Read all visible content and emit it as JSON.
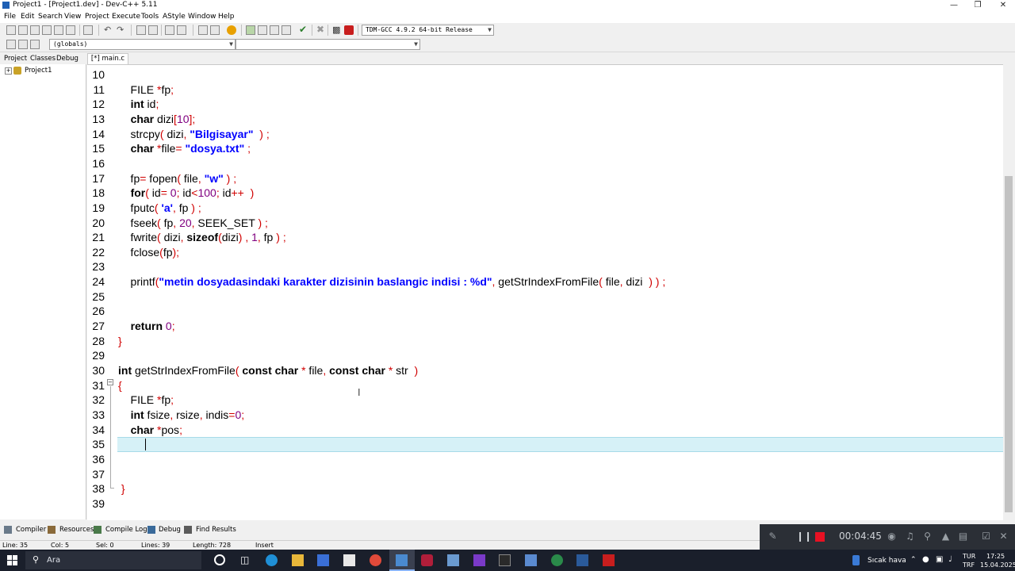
{
  "window": {
    "title": "Project1 - [Project1.dev] - Dev-C++ 5.11"
  },
  "menu": [
    "File",
    "Edit",
    "Search",
    "View",
    "Project",
    "Execute",
    "Tools",
    "AStyle",
    "Window",
    "Help"
  ],
  "toolbar": {
    "compiler": "TDM-GCC 4.9.2 64-bit Release",
    "scope": "(globals)",
    "member": ""
  },
  "left_tabs": [
    "Project",
    "Classes",
    "Debug"
  ],
  "project_tree": {
    "root": "Project1"
  },
  "editor": {
    "tab": "[*] main.c",
    "lines": [
      {
        "n": "10",
        "t": []
      },
      {
        "n": "11",
        "t": [
          {
            "c": "    FILE "
          },
          {
            "c": "*",
            "s": "sym"
          },
          {
            "c": "fp"
          },
          {
            "c": ";",
            "s": "sym"
          }
        ]
      },
      {
        "n": "12",
        "t": [
          {
            "c": "    "
          },
          {
            "c": "int",
            "s": "kw"
          },
          {
            "c": " id"
          },
          {
            "c": ";",
            "s": "sym"
          }
        ]
      },
      {
        "n": "13",
        "t": [
          {
            "c": "    "
          },
          {
            "c": "char",
            "s": "kw"
          },
          {
            "c": " dizi"
          },
          {
            "c": "[",
            "s": "sym"
          },
          {
            "c": "10",
            "s": "num"
          },
          {
            "c": "];",
            "s": "sym"
          }
        ]
      },
      {
        "n": "14",
        "t": [
          {
            "c": "    strcpy"
          },
          {
            "c": "(",
            "s": "sym"
          },
          {
            "c": " dizi"
          },
          {
            "c": ",",
            "s": "sym"
          },
          {
            "c": " "
          },
          {
            "c": "\"Bilgisayar\"",
            "s": "str"
          },
          {
            "c": "  "
          },
          {
            "c": ")",
            "s": "sym"
          },
          {
            "c": " "
          },
          {
            "c": ";",
            "s": "sym"
          }
        ]
      },
      {
        "n": "15",
        "t": [
          {
            "c": "    "
          },
          {
            "c": "char",
            "s": "kw"
          },
          {
            "c": " "
          },
          {
            "c": "*",
            "s": "sym"
          },
          {
            "c": "file"
          },
          {
            "c": "=",
            "s": "sym"
          },
          {
            "c": " "
          },
          {
            "c": "\"dosya.txt\"",
            "s": "str"
          },
          {
            "c": " "
          },
          {
            "c": ";",
            "s": "sym"
          }
        ]
      },
      {
        "n": "16",
        "t": []
      },
      {
        "n": "17",
        "t": [
          {
            "c": "    fp"
          },
          {
            "c": "=",
            "s": "sym"
          },
          {
            "c": " fopen"
          },
          {
            "c": "(",
            "s": "sym"
          },
          {
            "c": " file"
          },
          {
            "c": ",",
            "s": "sym"
          },
          {
            "c": " "
          },
          {
            "c": "\"w\"",
            "s": "str"
          },
          {
            "c": " "
          },
          {
            "c": ")",
            "s": "sym"
          },
          {
            "c": " "
          },
          {
            "c": ";",
            "s": "sym"
          }
        ]
      },
      {
        "n": "18",
        "t": [
          {
            "c": "    "
          },
          {
            "c": "for",
            "s": "kw"
          },
          {
            "c": "(",
            "s": "sym"
          },
          {
            "c": " id"
          },
          {
            "c": "=",
            "s": "sym"
          },
          {
            "c": " "
          },
          {
            "c": "0",
            "s": "num"
          },
          {
            "c": ";",
            "s": "sym"
          },
          {
            "c": " id"
          },
          {
            "c": "<",
            "s": "sym"
          },
          {
            "c": "100",
            "s": "num"
          },
          {
            "c": ";",
            "s": "sym"
          },
          {
            "c": " id"
          },
          {
            "c": "++",
            "s": "sym"
          },
          {
            "c": "  "
          },
          {
            "c": ")",
            "s": "sym"
          }
        ]
      },
      {
        "n": "19",
        "t": [
          {
            "c": "    fputc"
          },
          {
            "c": "(",
            "s": "sym"
          },
          {
            "c": " "
          },
          {
            "c": "'a'",
            "s": "str"
          },
          {
            "c": ",",
            "s": "sym"
          },
          {
            "c": " fp "
          },
          {
            "c": ")",
            "s": "sym"
          },
          {
            "c": " "
          },
          {
            "c": ";",
            "s": "sym"
          }
        ]
      },
      {
        "n": "20",
        "t": [
          {
            "c": "    fseek"
          },
          {
            "c": "(",
            "s": "sym"
          },
          {
            "c": " fp"
          },
          {
            "c": ",",
            "s": "sym"
          },
          {
            "c": " "
          },
          {
            "c": "20",
            "s": "num"
          },
          {
            "c": ",",
            "s": "sym"
          },
          {
            "c": " SEEK_SET "
          },
          {
            "c": ")",
            "s": "sym"
          },
          {
            "c": " "
          },
          {
            "c": ";",
            "s": "sym"
          }
        ]
      },
      {
        "n": "21",
        "t": [
          {
            "c": "    fwrite"
          },
          {
            "c": "(",
            "s": "sym"
          },
          {
            "c": " dizi"
          },
          {
            "c": ",",
            "s": "sym"
          },
          {
            "c": " "
          },
          {
            "c": "sizeof",
            "s": "kw"
          },
          {
            "c": "(",
            "s": "sym"
          },
          {
            "c": "dizi"
          },
          {
            "c": ")",
            "s": "sym"
          },
          {
            "c": " "
          },
          {
            "c": ",",
            "s": "sym"
          },
          {
            "c": " "
          },
          {
            "c": "1",
            "s": "num"
          },
          {
            "c": ",",
            "s": "sym"
          },
          {
            "c": " fp "
          },
          {
            "c": ")",
            "s": "sym"
          },
          {
            "c": " "
          },
          {
            "c": ";",
            "s": "sym"
          }
        ]
      },
      {
        "n": "22",
        "t": [
          {
            "c": "    fclose"
          },
          {
            "c": "(",
            "s": "sym"
          },
          {
            "c": "fp"
          },
          {
            "c": ");",
            "s": "sym"
          }
        ]
      },
      {
        "n": "23",
        "t": []
      },
      {
        "n": "24",
        "t": [
          {
            "c": "    printf"
          },
          {
            "c": "(",
            "s": "sym"
          },
          {
            "c": "\"metin dosyadasindaki karakter dizisinin baslangic indisi : %d\"",
            "s": "str"
          },
          {
            "c": ",",
            "s": "sym"
          },
          {
            "c": " getStrIndexFromFile"
          },
          {
            "c": "(",
            "s": "sym"
          },
          {
            "c": " file"
          },
          {
            "c": ",",
            "s": "sym"
          },
          {
            "c": " dizi  "
          },
          {
            "c": ")",
            "s": "sym"
          },
          {
            "c": " "
          },
          {
            "c": ")",
            "s": "sym"
          },
          {
            "c": " "
          },
          {
            "c": ";",
            "s": "sym"
          }
        ]
      },
      {
        "n": "25",
        "t": []
      },
      {
        "n": "26",
        "t": []
      },
      {
        "n": "27",
        "t": [
          {
            "c": "    "
          },
          {
            "c": "return",
            "s": "kw"
          },
          {
            "c": " "
          },
          {
            "c": "0",
            "s": "num"
          },
          {
            "c": ";",
            "s": "sym"
          }
        ]
      },
      {
        "n": "28",
        "t": [
          {
            "c": "}",
            "s": "brace"
          }
        ]
      },
      {
        "n": "29",
        "t": []
      },
      {
        "n": "30",
        "t": [
          {
            "c": "int",
            "s": "kw"
          },
          {
            "c": " getStrIndexFromFile"
          },
          {
            "c": "(",
            "s": "sym"
          },
          {
            "c": " "
          },
          {
            "c": "const",
            "s": "kw"
          },
          {
            "c": " "
          },
          {
            "c": "char",
            "s": "kw"
          },
          {
            "c": " "
          },
          {
            "c": "*",
            "s": "sym"
          },
          {
            "c": " file"
          },
          {
            "c": ",",
            "s": "sym"
          },
          {
            "c": " "
          },
          {
            "c": "const",
            "s": "kw"
          },
          {
            "c": " "
          },
          {
            "c": "char",
            "s": "kw"
          },
          {
            "c": " "
          },
          {
            "c": "*",
            "s": "sym"
          },
          {
            "c": " str  "
          },
          {
            "c": ")",
            "s": "sym"
          }
        ]
      },
      {
        "n": "31",
        "t": [
          {
            "c": "{",
            "s": "brace"
          }
        ]
      },
      {
        "n": "32",
        "t": [
          {
            "c": "    FILE "
          },
          {
            "c": "*",
            "s": "sym"
          },
          {
            "c": "fp"
          },
          {
            "c": ";",
            "s": "sym"
          }
        ]
      },
      {
        "n": "33",
        "t": [
          {
            "c": "    "
          },
          {
            "c": "int",
            "s": "kw"
          },
          {
            "c": " fsize"
          },
          {
            "c": ",",
            "s": "sym"
          },
          {
            "c": " rsize"
          },
          {
            "c": ",",
            "s": "sym"
          },
          {
            "c": " indis"
          },
          {
            "c": "=",
            "s": "sym"
          },
          {
            "c": "0",
            "s": "num"
          },
          {
            "c": ";",
            "s": "sym"
          }
        ]
      },
      {
        "n": "34",
        "t": [
          {
            "c": "    "
          },
          {
            "c": "char",
            "s": "kw"
          },
          {
            "c": " "
          },
          {
            "c": "*",
            "s": "sym"
          },
          {
            "c": "pos"
          },
          {
            "c": ";",
            "s": "sym"
          }
        ]
      },
      {
        "n": "35",
        "t": []
      },
      {
        "n": "36",
        "t": []
      },
      {
        "n": "37",
        "t": []
      },
      {
        "n": "38",
        "t": [
          {
            "c": " }",
            "s": "brace"
          }
        ]
      },
      {
        "n": "39",
        "t": []
      }
    ]
  },
  "bottom_tabs": [
    "Compiler",
    "Resources",
    "Compile Log",
    "Debug",
    "Find Results"
  ],
  "status": {
    "line": "Line:   35",
    "col": "Col:   5",
    "sel": "Sel:   0",
    "lines": "Lines:   39",
    "length": "Length:   728",
    "mode": "Insert"
  },
  "recorder": {
    "time": "00:04:45",
    "colors": {
      "stop": "#e81123"
    }
  },
  "taskbar": {
    "search": "Ara",
    "weather": "Sıcak hava",
    "lang_top": "TUR",
    "lang_bottom": "TRF",
    "time": "17:25",
    "date": "15.04.2025"
  },
  "colors": {
    "current_line": "#d6f1f7",
    "string": "#0000ff",
    "symbol": "#d00000",
    "number": "#800080"
  }
}
